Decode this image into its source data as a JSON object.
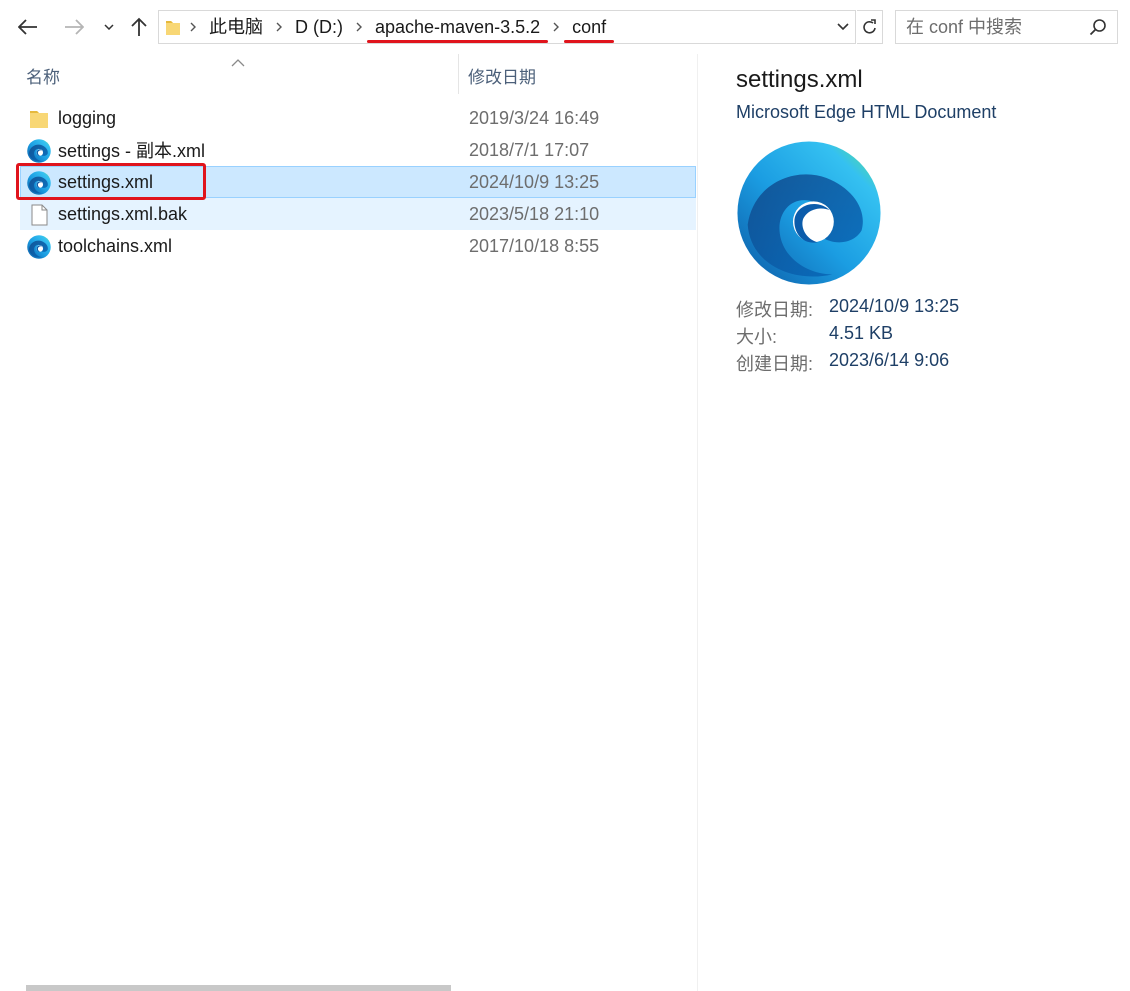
{
  "address_bar": {
    "crumbs": [
      {
        "label": "此电脑"
      },
      {
        "label": "D (D:)"
      },
      {
        "label": "apache-maven-3.5.2"
      },
      {
        "label": "conf"
      }
    ]
  },
  "search": {
    "placeholder": "在 conf 中搜索"
  },
  "list": {
    "columns": {
      "name": "名称",
      "date_modified": "修改日期"
    },
    "rows": [
      {
        "name": "logging",
        "date": "2019/3/24 16:49",
        "icon": "folder-icon"
      },
      {
        "name": "settings - 副本.xml",
        "date": "2018/7/1 17:07",
        "icon": "edge-icon"
      },
      {
        "name": "settings.xml",
        "date": "2024/10/9 13:25",
        "icon": "edge-icon"
      },
      {
        "name": "settings.xml.bak",
        "date": "2023/5/18 21:10",
        "icon": "file-icon"
      },
      {
        "name": "toolchains.xml",
        "date": "2017/10/18 8:55",
        "icon": "edge-icon"
      }
    ]
  },
  "details": {
    "title": "settings.xml",
    "type": "Microsoft Edge HTML Document",
    "icon": "edge-logo",
    "props": [
      {
        "label": "修改日期:",
        "value": "2024/10/9 13:25"
      },
      {
        "label": "大小:",
        "value": "4.51 KB"
      },
      {
        "label": "创建日期:",
        "value": "2023/6/14 9:06"
      }
    ]
  },
  "colors": {
    "selection": "#cce8ff",
    "hover": "#e5f3ff",
    "annotation_red": "#e0141c",
    "header_text": "#4c607a",
    "detail_value": "#1e3f66"
  }
}
